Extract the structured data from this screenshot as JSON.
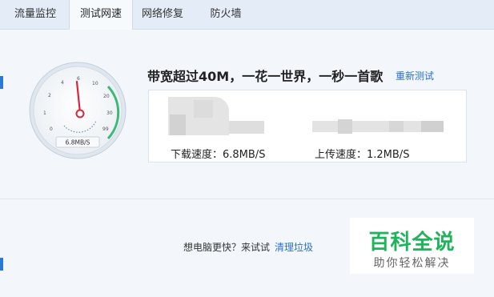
{
  "tabs": [
    {
      "label": "流量监控",
      "active": false
    },
    {
      "label": "测试网速",
      "active": true
    },
    {
      "label": "网络修复",
      "active": false
    },
    {
      "label": "防火墙",
      "active": false
    }
  ],
  "gauge": {
    "ticks": [
      "0",
      "1",
      "2",
      "4",
      "6",
      "10",
      "20",
      "30",
      "99"
    ],
    "readout": "6.8MB/S",
    "needle_value": 6.8
  },
  "result": {
    "headline": "带宽超过40M，一花一世界，一秒一首歌",
    "retest_label": "重新测试",
    "download_label": "下载速度：6.8MB/S",
    "upload_label": "上传速度：1.2MB/S"
  },
  "promo": {
    "text": "想电脑更快？来试试",
    "link_label": "清理垃圾"
  },
  "watermark": {
    "title": "百科全说",
    "subtitle": "助你轻松解决"
  },
  "colors": {
    "accent": "#2a6fcd",
    "needle": "#d7263d",
    "gauge_green": "#3cb878",
    "watermark_green": "#1fb35b"
  }
}
